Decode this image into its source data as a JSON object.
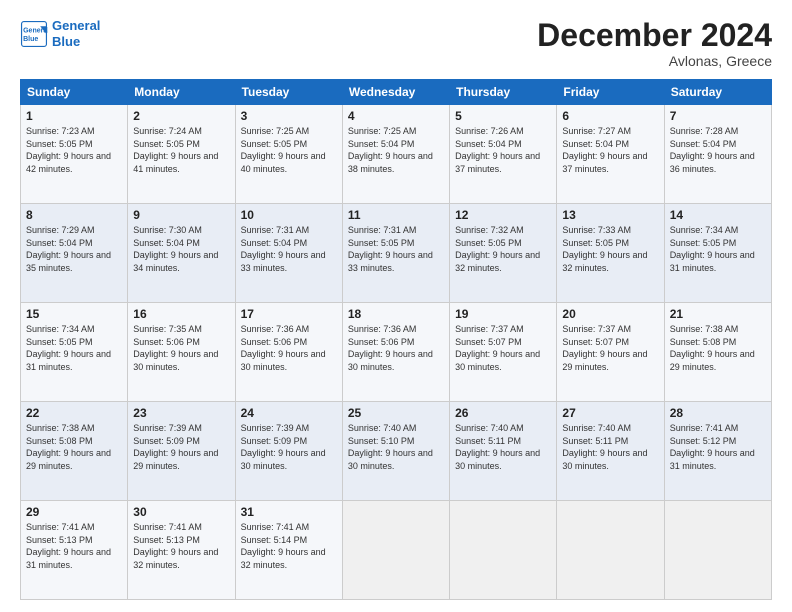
{
  "logo": {
    "line1": "General",
    "line2": "Blue"
  },
  "title": "December 2024",
  "location": "Avlonas, Greece",
  "weekdays": [
    "Sunday",
    "Monday",
    "Tuesday",
    "Wednesday",
    "Thursday",
    "Friday",
    "Saturday"
  ],
  "weeks": [
    [
      {
        "day": "1",
        "sunrise": "7:23 AM",
        "sunset": "5:05 PM",
        "daylight": "9 hours and 42 minutes."
      },
      {
        "day": "2",
        "sunrise": "7:24 AM",
        "sunset": "5:05 PM",
        "daylight": "9 hours and 41 minutes."
      },
      {
        "day": "3",
        "sunrise": "7:25 AM",
        "sunset": "5:05 PM",
        "daylight": "9 hours and 40 minutes."
      },
      {
        "day": "4",
        "sunrise": "7:25 AM",
        "sunset": "5:04 PM",
        "daylight": "9 hours and 38 minutes."
      },
      {
        "day": "5",
        "sunrise": "7:26 AM",
        "sunset": "5:04 PM",
        "daylight": "9 hours and 37 minutes."
      },
      {
        "day": "6",
        "sunrise": "7:27 AM",
        "sunset": "5:04 PM",
        "daylight": "9 hours and 37 minutes."
      },
      {
        "day": "7",
        "sunrise": "7:28 AM",
        "sunset": "5:04 PM",
        "daylight": "9 hours and 36 minutes."
      }
    ],
    [
      {
        "day": "8",
        "sunrise": "7:29 AM",
        "sunset": "5:04 PM",
        "daylight": "9 hours and 35 minutes."
      },
      {
        "day": "9",
        "sunrise": "7:30 AM",
        "sunset": "5:04 PM",
        "daylight": "9 hours and 34 minutes."
      },
      {
        "day": "10",
        "sunrise": "7:31 AM",
        "sunset": "5:04 PM",
        "daylight": "9 hours and 33 minutes."
      },
      {
        "day": "11",
        "sunrise": "7:31 AM",
        "sunset": "5:05 PM",
        "daylight": "9 hours and 33 minutes."
      },
      {
        "day": "12",
        "sunrise": "7:32 AM",
        "sunset": "5:05 PM",
        "daylight": "9 hours and 32 minutes."
      },
      {
        "day": "13",
        "sunrise": "7:33 AM",
        "sunset": "5:05 PM",
        "daylight": "9 hours and 32 minutes."
      },
      {
        "day": "14",
        "sunrise": "7:34 AM",
        "sunset": "5:05 PM",
        "daylight": "9 hours and 31 minutes."
      }
    ],
    [
      {
        "day": "15",
        "sunrise": "7:34 AM",
        "sunset": "5:05 PM",
        "daylight": "9 hours and 31 minutes."
      },
      {
        "day": "16",
        "sunrise": "7:35 AM",
        "sunset": "5:06 PM",
        "daylight": "9 hours and 30 minutes."
      },
      {
        "day": "17",
        "sunrise": "7:36 AM",
        "sunset": "5:06 PM",
        "daylight": "9 hours and 30 minutes."
      },
      {
        "day": "18",
        "sunrise": "7:36 AM",
        "sunset": "5:06 PM",
        "daylight": "9 hours and 30 minutes."
      },
      {
        "day": "19",
        "sunrise": "7:37 AM",
        "sunset": "5:07 PM",
        "daylight": "9 hours and 30 minutes."
      },
      {
        "day": "20",
        "sunrise": "7:37 AM",
        "sunset": "5:07 PM",
        "daylight": "9 hours and 29 minutes."
      },
      {
        "day": "21",
        "sunrise": "7:38 AM",
        "sunset": "5:08 PM",
        "daylight": "9 hours and 29 minutes."
      }
    ],
    [
      {
        "day": "22",
        "sunrise": "7:38 AM",
        "sunset": "5:08 PM",
        "daylight": "9 hours and 29 minutes."
      },
      {
        "day": "23",
        "sunrise": "7:39 AM",
        "sunset": "5:09 PM",
        "daylight": "9 hours and 29 minutes."
      },
      {
        "day": "24",
        "sunrise": "7:39 AM",
        "sunset": "5:09 PM",
        "daylight": "9 hours and 30 minutes."
      },
      {
        "day": "25",
        "sunrise": "7:40 AM",
        "sunset": "5:10 PM",
        "daylight": "9 hours and 30 minutes."
      },
      {
        "day": "26",
        "sunrise": "7:40 AM",
        "sunset": "5:11 PM",
        "daylight": "9 hours and 30 minutes."
      },
      {
        "day": "27",
        "sunrise": "7:40 AM",
        "sunset": "5:11 PM",
        "daylight": "9 hours and 30 minutes."
      },
      {
        "day": "28",
        "sunrise": "7:41 AM",
        "sunset": "5:12 PM",
        "daylight": "9 hours and 31 minutes."
      }
    ],
    [
      {
        "day": "29",
        "sunrise": "7:41 AM",
        "sunset": "5:13 PM",
        "daylight": "9 hours and 31 minutes."
      },
      {
        "day": "30",
        "sunrise": "7:41 AM",
        "sunset": "5:13 PM",
        "daylight": "9 hours and 32 minutes."
      },
      {
        "day": "31",
        "sunrise": "7:41 AM",
        "sunset": "5:14 PM",
        "daylight": "9 hours and 32 minutes."
      },
      null,
      null,
      null,
      null
    ]
  ]
}
